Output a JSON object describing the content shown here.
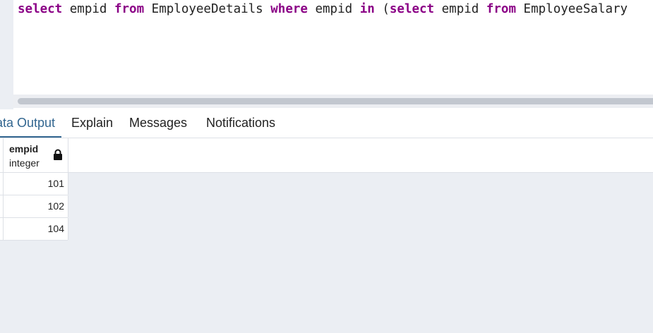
{
  "editor": {
    "query_tokens": [
      {
        "text": "select",
        "kind": "keyword"
      },
      {
        "text": " empid ",
        "kind": "identifier"
      },
      {
        "text": "from",
        "kind": "keyword"
      },
      {
        "text": " EmployeeDetails ",
        "kind": "identifier"
      },
      {
        "text": "where",
        "kind": "keyword"
      },
      {
        "text": " empid ",
        "kind": "identifier"
      },
      {
        "text": "in",
        "kind": "keyword"
      },
      {
        "text": " (",
        "kind": "identifier"
      },
      {
        "text": "select",
        "kind": "keyword"
      },
      {
        "text": " empid ",
        "kind": "identifier"
      },
      {
        "text": "from",
        "kind": "keyword"
      },
      {
        "text": " EmployeeSalary",
        "kind": "identifier"
      }
    ],
    "keyword_color": "#8b0086"
  },
  "tabs": [
    {
      "label": "ata Output",
      "active": true
    },
    {
      "label": "Explain",
      "active": false
    },
    {
      "label": "Messages",
      "active": false
    },
    {
      "label": "Notifications",
      "active": false
    }
  ],
  "accent_color": "#326690",
  "grid": {
    "columns": [
      {
        "name": "empid",
        "type": "integer",
        "icon": "lock-icon"
      }
    ],
    "rows": [
      {
        "empid": "101"
      },
      {
        "empid": "102"
      },
      {
        "empid": "104"
      }
    ]
  }
}
